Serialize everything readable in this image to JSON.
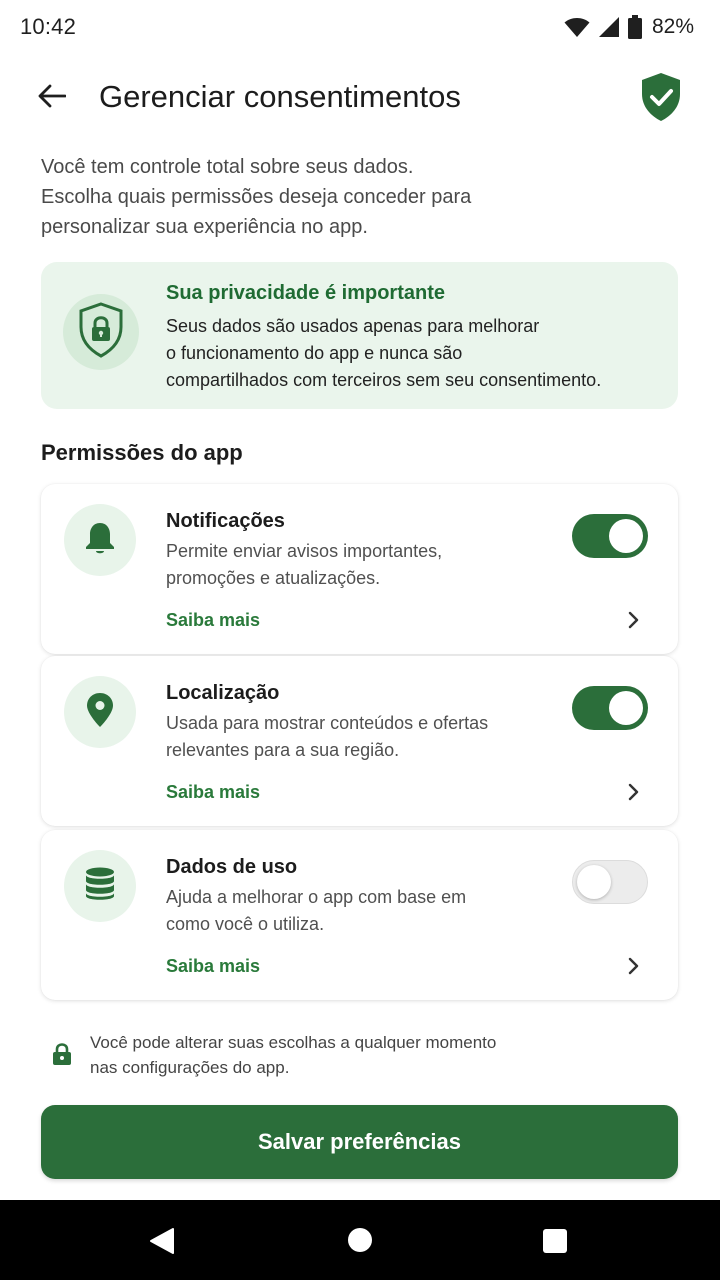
{
  "status_bar": {
    "time": "10:42",
    "battery": "82%",
    "icons": [
      "wifi-icon",
      "signal-icon",
      "battery-icon"
    ]
  },
  "header": {
    "title": "Gerenciar consentimentos",
    "back_icon": "arrow-left-icon",
    "badge_icon": "shield-check-icon"
  },
  "intro": {
    "lines": [
      "Você tem controle total sobre seus dados.",
      "Escolha quais permissões deseja conceder para",
      "personalizar sua experiência no app."
    ]
  },
  "privacy_card": {
    "icon": "shield-lock-icon",
    "title": "Sua privacidade é importante",
    "lines": [
      "Seus dados são usados apenas para melhorar",
      "o funcionamento do app e nunca são",
      "compartilhados com terceiros sem seu consentimento."
    ]
  },
  "permissions": {
    "section_title": "Permissões do app",
    "items": [
      {
        "icon": "bell-icon",
        "title": "Notificações",
        "desc_lines": [
          "Permite enviar avisos importantes,",
          "promoções e atualizações."
        ],
        "link": "Saiba mais",
        "enabled": true
      },
      {
        "icon": "location-pin-icon",
        "title": "Localização",
        "desc_lines": [
          "Usada para mostrar conteúdos e ofertas",
          "relevantes para a sua região."
        ],
        "link": "Saiba mais",
        "enabled": true
      },
      {
        "icon": "database-icon",
        "title": "Dados de uso",
        "desc_lines": [
          "Ajuda a melhorar o app com base em",
          "como você o utiliza."
        ],
        "link": "Saiba mais",
        "enabled": false
      }
    ]
  },
  "footnote": {
    "icon": "lock-icon",
    "lines": [
      "Você pode alterar suas escolhas a qualquer momento",
      "nas configurações do app."
    ]
  },
  "actions": {
    "save_label": "Salvar preferências"
  },
  "colors": {
    "primary": "#2b6e3a",
    "primary_text": "#1f6b33",
    "card_tint": "#eaf5ec",
    "icon_circle": "#e8f4ea"
  }
}
